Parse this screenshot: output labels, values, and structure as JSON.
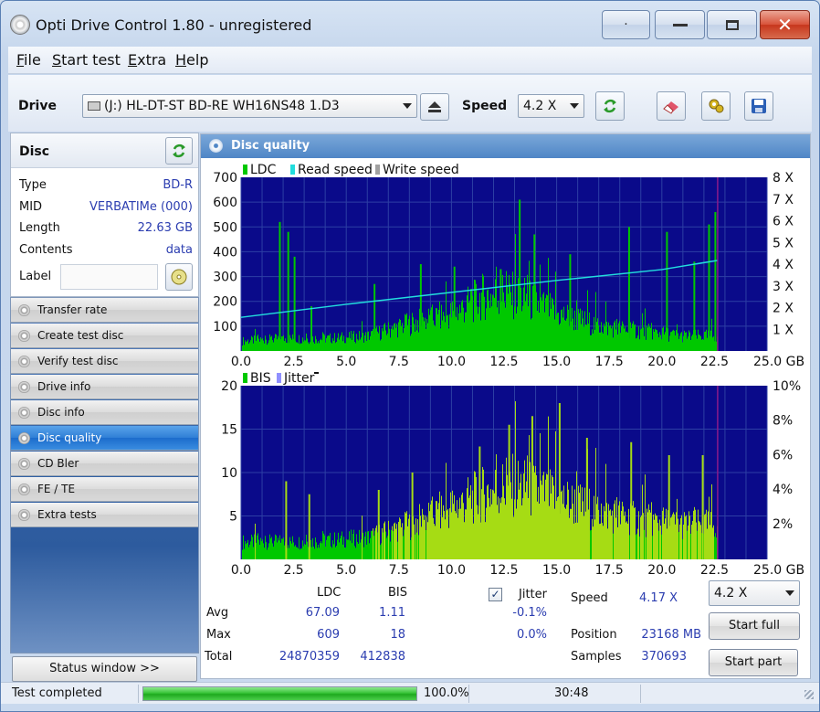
{
  "window": {
    "title": "Opti Drive Control 1.80 - unregistered",
    "min": "▁",
    "max": "□",
    "close": "✕",
    "restore": "·"
  },
  "menu": [
    {
      "label": "File",
      "ul": "F",
      "rest": "ile"
    },
    {
      "label": "Start test",
      "ul": "S",
      "rest": "tart test"
    },
    {
      "label": "Extra",
      "ul": "E",
      "rest": "xtra"
    },
    {
      "label": "Help",
      "ul": "H",
      "rest": "elp"
    }
  ],
  "toolbar": {
    "drive_label": "Drive",
    "drive_value": "(J:)   HL-DT-ST BD-RE  WH16NS48 1.D3",
    "speed_label": "Speed",
    "speed_value": "4.2 X"
  },
  "disc": {
    "title": "Disc",
    "rows": [
      {
        "key": "Type",
        "value": "BD-R"
      },
      {
        "key": "MID",
        "value": "VERBATIMe (000)"
      },
      {
        "key": "Length",
        "value": "22.63 GB"
      },
      {
        "key": "Contents",
        "value": "data"
      }
    ],
    "label_key": "Label",
    "label_value": ""
  },
  "nav": [
    {
      "label": "Transfer rate",
      "selected": false
    },
    {
      "label": "Create test disc",
      "selected": false
    },
    {
      "label": "Verify test disc",
      "selected": false
    },
    {
      "label": "Drive info",
      "selected": false
    },
    {
      "label": "Disc info",
      "selected": false
    },
    {
      "label": "Disc quality",
      "selected": true
    },
    {
      "label": "CD Bler",
      "selected": false
    },
    {
      "label": "FE / TE",
      "selected": false
    },
    {
      "label": "Extra tests",
      "selected": false
    }
  ],
  "status_window_button": "Status window >>",
  "panel_title": "Disc quality",
  "chart_data": [
    {
      "type": "bar",
      "legend": [
        "LDC",
        "Read speed",
        "Write speed"
      ],
      "colors": {
        "LDC": "#00c800",
        "Read speed": "#22dddd",
        "Write speed": "#a0a0a0",
        "background": "#0a0a8a"
      },
      "x_range": [
        0,
        25
      ],
      "x_ticks": [
        "0.0",
        "2.5",
        "5.0",
        "7.5",
        "10.0",
        "12.5",
        "15.0",
        "17.5",
        "20.0",
        "22.5",
        "25.0 GB"
      ],
      "y_left_range": [
        0,
        700
      ],
      "y_left_ticks": [
        "700",
        "600",
        "500",
        "400",
        "300",
        "200",
        "100"
      ],
      "y_right_range": [
        0,
        8
      ],
      "y_right_ticks": [
        "8 X",
        "7 X",
        "6 X",
        "5 X",
        "4 X",
        "3 X",
        "2 X",
        "1 X"
      ],
      "data_end_gb": 22.63,
      "ldc_base": {
        "x": [
          0,
          2,
          4,
          6,
          8,
          10,
          11.5,
          12.5,
          13.5,
          15,
          17,
          19,
          21,
          22.63
        ],
        "y": [
          40,
          50,
          50,
          60,
          110,
          150,
          220,
          230,
          210,
          150,
          100,
          80,
          60,
          60
        ]
      },
      "ldc_spikes": {
        "x": [
          1.8,
          2.2,
          2.5,
          3.3,
          6.3,
          8.5,
          10.1,
          10.9,
          12.3,
          13.2,
          13.9,
          15.6,
          18.4,
          20.2,
          21.5,
          22.2,
          22.5
        ],
        "y": [
          520,
          480,
          380,
          180,
          270,
          350,
          340,
          250,
          330,
          610,
          470,
          390,
          500,
          480,
          360,
          510,
          560
        ]
      },
      "read_speed": {
        "x": [
          0,
          5,
          10,
          15,
          20,
          22.63
        ],
        "y": [
          1.55,
          2.15,
          2.7,
          3.25,
          3.75,
          4.17
        ]
      }
    },
    {
      "type": "bar",
      "legend": [
        "BIS",
        "Jitter"
      ],
      "colors": {
        "BIS": "#00c800",
        "BIS_high": "#a6dc14",
        "Jitter": "#9090ff",
        "background": "#0a0a8a"
      },
      "x_range": [
        0,
        25
      ],
      "x_ticks": [
        "0.0",
        "2.5",
        "5.0",
        "7.5",
        "10.0",
        "12.5",
        "15.0",
        "17.5",
        "20.0",
        "22.5",
        "25.0 GB"
      ],
      "y_left_range": [
        0,
        20
      ],
      "y_left_ticks": [
        "20",
        "15",
        "10",
        "5"
      ],
      "y_right_ticks": [
        "10%",
        "8%",
        "6%",
        "4%",
        "2%"
      ],
      "data_end_gb": 22.63,
      "bis_base": {
        "x": [
          0,
          3,
          6,
          8,
          10,
          12,
          13,
          15,
          17,
          19,
          21,
          22.63
        ],
        "y": [
          2,
          2,
          2.5,
          4,
          6,
          8,
          8.5,
          7,
          5.5,
          4.5,
          4,
          4
        ]
      },
      "bis_spikes": {
        "x": [
          2.1,
          3.2,
          6.5,
          8.1,
          11.3,
          12.7,
          13.8,
          15.1,
          16.4,
          18.5,
          20.3,
          21.9
        ],
        "y": [
          9,
          7.5,
          8,
          10,
          13,
          15.5,
          16.5,
          18,
          14,
          13.5,
          12,
          12
        ]
      }
    }
  ],
  "stats": {
    "col_ldc": "LDC",
    "col_bis": "BIS",
    "col_jitter": "Jitter",
    "rows": [
      {
        "label": "Avg",
        "ldc": "67.09",
        "bis": "1.11",
        "jitter": "-0.1%"
      },
      {
        "label": "Max",
        "ldc": "609",
        "bis": "18",
        "jitter": "0.0%"
      },
      {
        "label": "Total",
        "ldc": "24870359",
        "bis": "412838",
        "jitter": ""
      }
    ],
    "jitter_checked": true,
    "speed_label": "Speed",
    "speed_value": "4.17 X",
    "position_label": "Position",
    "position_value": "23168 MB",
    "samples_label": "Samples",
    "samples_value": "370693",
    "speed_select": "4.2 X",
    "start_full": "Start full",
    "start_part": "Start part"
  },
  "statusbar": {
    "text": "Test completed",
    "progress": 1.0,
    "progress_text": "100.0%",
    "time": "30:48"
  }
}
